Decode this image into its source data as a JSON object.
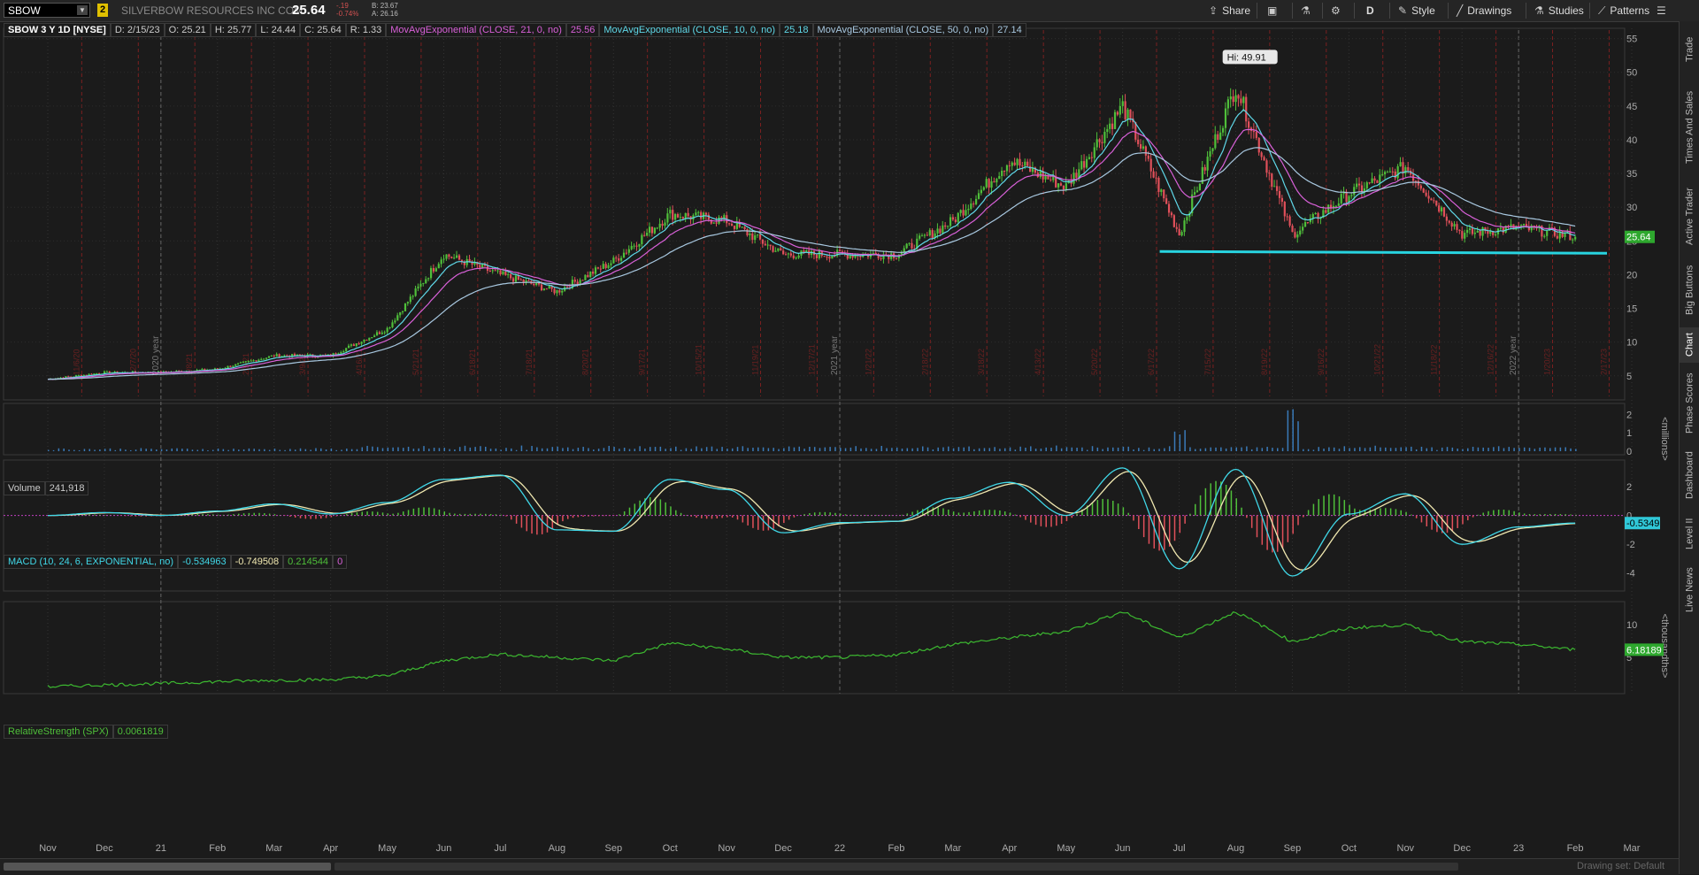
{
  "topbar": {
    "symbol": "SBOW",
    "link_badge": "2",
    "company": "SILVERBOW RESOURCES INC COM",
    "last": "25.64",
    "change": "-.19",
    "change_pct": "-0.74%",
    "bid": "B: 23.67",
    "ask": "A: 26.16",
    "share": "Share",
    "aggregation": "D",
    "style": "Style",
    "drawings": "Drawings",
    "studies": "Studies",
    "patterns": "Patterns"
  },
  "price_panel": {
    "title": "SBOW 3 Y 1D [NYSE]",
    "date": "D: 2/15/23",
    "open": "O: 25.21",
    "high": "H: 25.77",
    "low": "L: 24.44",
    "close": "C: 25.64",
    "range": "R: 1.33",
    "ema21_label": "MovAvgExponential (CLOSE, 21, 0, no)",
    "ema21_value": "25.56",
    "ema10_label": "MovAvgExponential (CLOSE, 10, 0, no)",
    "ema10_value": "25.18",
    "ema50_label": "MovAvgExponential (CLOSE, 50, 0, no)",
    "ema50_value": "27.14",
    "hi_bubble": "Hi: 49.91",
    "last_tag": "25.64",
    "year_markers": [
      "2020 year",
      "2021 year",
      "2022 year"
    ],
    "date_markers": [
      "11/6/20",
      "12/7/20",
      "1/8/21",
      "2/9/21",
      "3/9/21",
      "4/16/21",
      "5/21/21",
      "6/18/21",
      "7/18/21",
      "8/20/21",
      "9/17/21",
      "10/15/21",
      "11/19/21",
      "12/17/21",
      "1/21/22",
      "2/18/22",
      "3/18/22",
      "4/13/22",
      "5/20/22",
      "6/17/22",
      "7/15/22",
      "8/19/22",
      "9/16/22",
      "10/21/22",
      "11/18/22",
      "12/16/22",
      "1/20/23",
      "2/17/23"
    ]
  },
  "volume_panel": {
    "label": "Volume",
    "value": "241,918",
    "unit": "<millions>",
    "ticks": [
      "2",
      "1",
      "0"
    ]
  },
  "macd_panel": {
    "label": "MACD (10, 24, 6, EXPONENTIAL, no)",
    "value": "-0.534963",
    "avg": "-0.749508",
    "diff": "0.214544",
    "zero": "0",
    "last_tag": "-0.5349"
  },
  "rs_panel": {
    "label": "RelativeStrength (SPX)",
    "value": "0.0061819",
    "unit": "<thousandths>",
    "last_tag": "6.18189"
  },
  "x_axis": [
    "Nov",
    "Dec",
    "21",
    "Feb",
    "Mar",
    "Apr",
    "May",
    "Jun",
    "Jul",
    "Aug",
    "Sep",
    "Oct",
    "Nov",
    "Dec",
    "22",
    "Feb",
    "Mar",
    "Apr",
    "May",
    "Jun",
    "Jul",
    "Aug",
    "Sep",
    "Oct",
    "Nov",
    "Dec",
    "23",
    "Feb",
    "Mar"
  ],
  "right_tabs": [
    "Trade",
    "Times And Sales",
    "Active Trader",
    "Big Buttons",
    "Chart",
    "Phase Scores",
    "Dashboard",
    "Level II",
    "Live News"
  ],
  "bottom": {
    "drawing_set": "Drawing set: Default"
  },
  "colors": {
    "up": "#4fbf3a",
    "down": "#e0505a",
    "ema10": "#5fd8e8",
    "ema21": "#d860d8",
    "ema50": "#a8c8e0",
    "support": "#28d4e0",
    "macd": "#40d8e8",
    "macd_avg": "#f0e8b0"
  },
  "chart_data": {
    "type": "line",
    "title": "SBOW 3 Y 1D [NYSE]",
    "x_months": [
      "Nov",
      "Dec",
      "21",
      "Feb",
      "Mar",
      "Apr",
      "May",
      "Jun",
      "Jul",
      "Aug",
      "Sep",
      "Oct",
      "Nov",
      "Dec",
      "22",
      "Feb",
      "Mar",
      "Apr",
      "May",
      "Jun",
      "Jul",
      "Aug",
      "Sep",
      "Oct",
      "Nov",
      "Dec",
      "23",
      "Feb",
      "Mar"
    ],
    "ylim": [
      3,
      56
    ],
    "y_ticks": [
      5,
      10,
      15,
      20,
      25,
      30,
      35,
      40,
      45,
      50,
      55
    ],
    "price_series": {
      "name": "SBOW",
      "months": [
        "Nov",
        "Dec",
        "21",
        "Feb",
        "Mar",
        "Apr",
        "May",
        "Jun",
        "Jul",
        "Aug",
        "Sep",
        "Oct",
        "Nov",
        "Dec",
        "22",
        "Feb",
        "Mar",
        "Apr",
        "May",
        "Jun",
        "Jul",
        "Aug",
        "Sep",
        "Oct",
        "Nov",
        "Dec",
        "23",
        "Feb"
      ],
      "values": [
        4.5,
        5.5,
        5.5,
        6,
        8,
        8,
        12,
        23,
        20,
        17.5,
        22,
        29,
        28,
        23,
        23,
        23,
        28,
        37,
        33,
        45,
        26,
        48,
        26,
        32,
        36,
        26,
        27,
        25.6
      ]
    },
    "high_point": {
      "label": "Hi: 49.91",
      "value": 49.91,
      "month": "Aug"
    },
    "support_level": 23.3,
    "volume": {
      "ylim": [
        0,
        2.4
      ],
      "y_ticks": [
        0,
        1,
        2
      ],
      "spikes": [
        {
          "month": "Jul",
          "value": 1.4
        },
        {
          "month": "Sep",
          "value": 2.3
        }
      ]
    },
    "macd": {
      "ylim": [
        -5,
        3.6
      ],
      "y_ticks": [
        -4,
        -2,
        0,
        2
      ],
      "values": [
        0,
        0.2,
        0,
        0.3,
        0.8,
        0.1,
        0.9,
        2.5,
        2.8,
        -1,
        -1.1,
        2.5,
        1.8,
        -1.2,
        -0.5,
        -0.4,
        1.2,
        2.3,
        0,
        3.3,
        -3.7,
        3.2,
        -4.2,
        0.1,
        1.5,
        -2,
        -0.8,
        -0.53
      ]
    },
    "relative_strength": {
      "ylim": [
        0,
        13
      ],
      "y_ticks": [
        5,
        10
      ],
      "values": [
        0.5,
        0.8,
        1,
        1.3,
        1.5,
        1.6,
        2.2,
        4.5,
        5.5,
        5,
        4.5,
        7.2,
        6.3,
        5,
        5,
        5.4,
        7,
        8,
        9,
        12,
        8,
        12,
        7.4,
        9.5,
        10,
        7.4,
        7,
        6.18
      ]
    }
  }
}
